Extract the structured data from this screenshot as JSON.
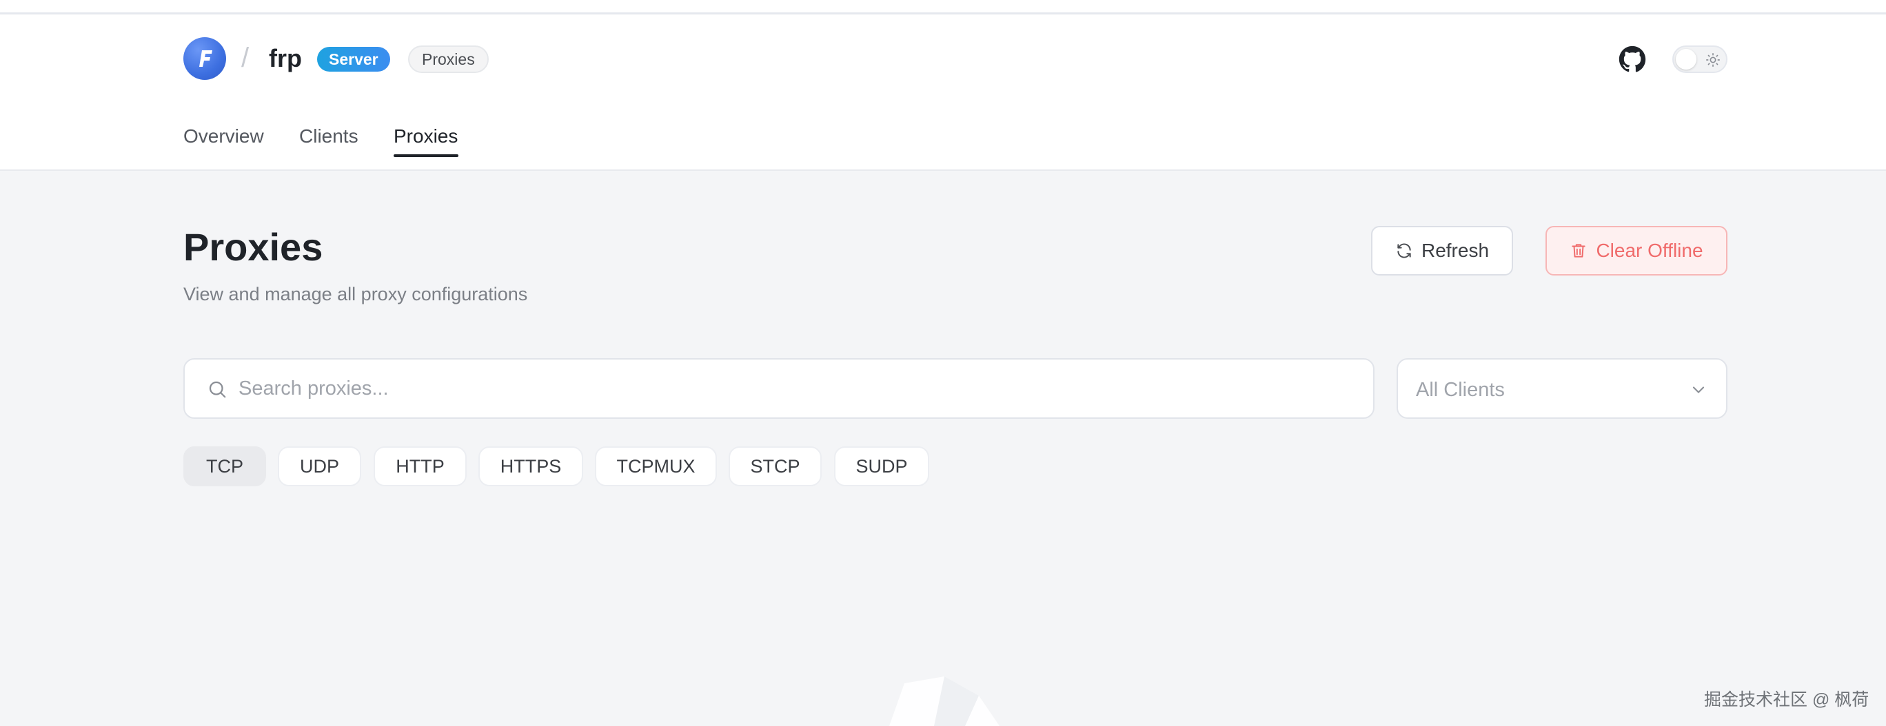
{
  "header": {
    "brand": "frp",
    "badge": "Server",
    "page_badge": "Proxies",
    "icons": {
      "logo": "frp-logo-icon",
      "github": "github-icon",
      "theme": "sun-icon"
    }
  },
  "nav": {
    "tabs": [
      {
        "label": "Overview",
        "active": false
      },
      {
        "label": "Clients",
        "active": false
      },
      {
        "label": "Proxies",
        "active": true
      }
    ]
  },
  "main": {
    "title": "Proxies",
    "subtitle": "View and manage all proxy configurations",
    "refresh_label": "Refresh",
    "clear_offline_label": "Clear Offline",
    "search_placeholder": "Search proxies...",
    "client_select_value": "All Clients",
    "proxy_types": [
      {
        "label": "TCP",
        "active": true
      },
      {
        "label": "UDP",
        "active": false
      },
      {
        "label": "HTTP",
        "active": false
      },
      {
        "label": "HTTPS",
        "active": false
      },
      {
        "label": "TCPMUX",
        "active": false
      },
      {
        "label": "STCP",
        "active": false
      },
      {
        "label": "SUDP",
        "active": false
      }
    ]
  },
  "watermark": "掘金技术社区 @ 枫荷",
  "colors": {
    "accent_blue": "#3d6fe0",
    "danger": "#f06b6b",
    "badge_gradient_start": "#1fa2e0",
    "badge_gradient_end": "#3b8df0"
  }
}
